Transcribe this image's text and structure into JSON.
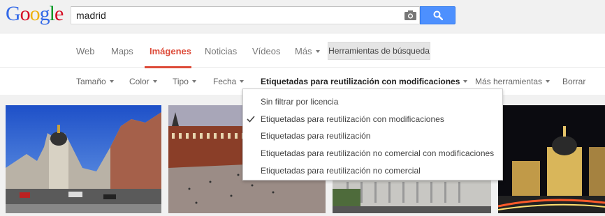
{
  "logo": "Google",
  "search": {
    "query": "madrid"
  },
  "tabs": [
    {
      "label": "Web"
    },
    {
      "label": "Maps"
    },
    {
      "label": "Imágenes"
    },
    {
      "label": "Noticias"
    },
    {
      "label": "Vídeos"
    },
    {
      "label": "Más"
    }
  ],
  "tools_button": "Herramientas de búsqueda",
  "toolbar": {
    "size": "Tamaño",
    "color": "Color",
    "type": "Tipo",
    "date": "Fecha",
    "license": "Etiquetadas para reutilización con modificaciones",
    "more_tools": "Más herramientas",
    "clear": "Borrar"
  },
  "license_menu": {
    "items": [
      {
        "label": "Sin filtrar por licencia"
      },
      {
        "label": "Etiquetadas para reutilización con modificaciones",
        "selected": true
      },
      {
        "label": "Etiquetadas para reutilización"
      },
      {
        "label": "Etiquetadas para reutilización no comercial con modificaciones"
      },
      {
        "label": "Etiquetadas para reutilización no comercial"
      }
    ]
  },
  "colors": {
    "accent_red": "#dd4b39",
    "search_blue": "#4d90fe",
    "logo_blue": "#3369e8",
    "logo_red": "#d50f25",
    "logo_yellow": "#eeb211",
    "logo_green": "#009925"
  }
}
